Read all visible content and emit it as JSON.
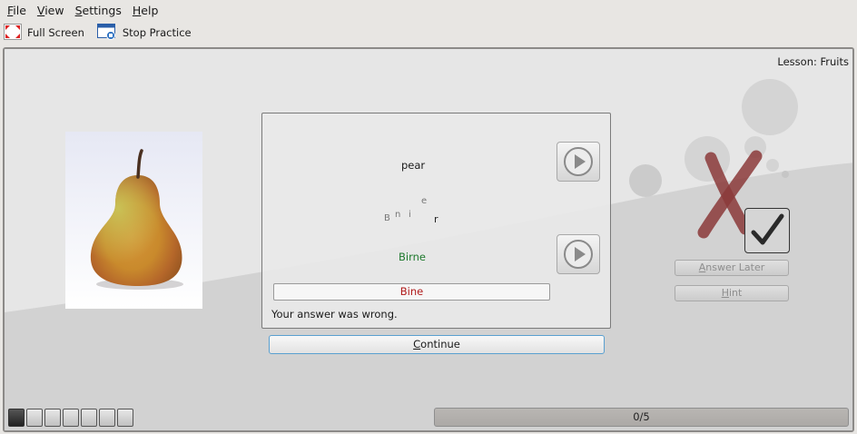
{
  "menu": [
    {
      "label": "File",
      "mnemonic": "F",
      "rest": "ile"
    },
    {
      "label": "View",
      "mnemonic": "V",
      "rest": "iew"
    },
    {
      "label": "Settings",
      "mnemonic": "S",
      "rest": "ettings"
    },
    {
      "label": "Help",
      "mnemonic": "H",
      "rest": "elp"
    }
  ],
  "toolbar": {
    "fullscreen_label": "Full Screen",
    "stop_label": "Stop Practice"
  },
  "lesson": "Lesson: Fruits",
  "card": {
    "question": "pear",
    "hint_letters": [
      "B",
      "n",
      "i",
      "e",
      "r"
    ],
    "solution": "Birne",
    "answer": "Bine",
    "feedback": "Your answer was wrong."
  },
  "continue": {
    "mnemonic": "C",
    "rest": "ontinue"
  },
  "side_buttons": {
    "answer_later": {
      "mnemonic": "A",
      "rest": "nswer Later"
    },
    "hint": {
      "mnemonic": "H",
      "rest": "int"
    }
  },
  "progress": {
    "text": "0/5",
    "value": 0,
    "max": 5
  },
  "colors": {
    "wrong": "#b01b1b",
    "correct": "#1f7a2e",
    "x_mark": "#8b3a3a"
  }
}
